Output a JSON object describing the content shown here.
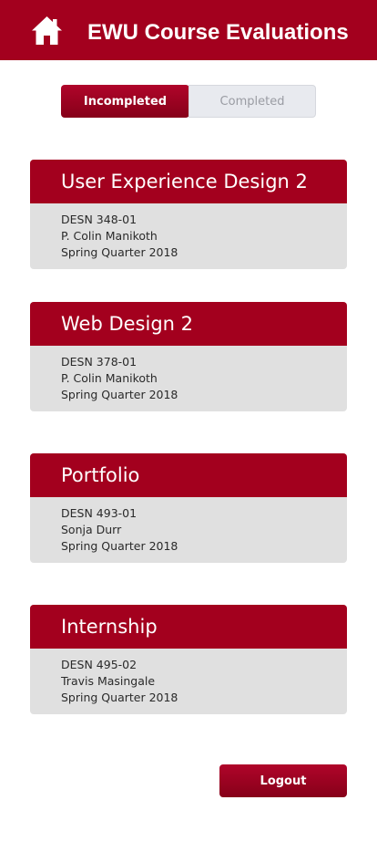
{
  "header": {
    "title": "EWU Course Evaluations",
    "home_icon": "home-icon",
    "bg_color": "#a3001e"
  },
  "tabs": [
    {
      "label": "Incompleted",
      "active": true
    },
    {
      "label": "Completed",
      "active": false
    }
  ],
  "courses": [
    {
      "title": "User Experience Design 2",
      "code": "DESN 348-01",
      "instructor": "P. Colin Manikoth",
      "term": "Spring Quarter 2018"
    },
    {
      "title": "Web Design 2",
      "code": "DESN 378-01",
      "instructor": "P. Colin Manikoth",
      "term": "Spring Quarter 2018"
    },
    {
      "title": "Portfolio",
      "code": "DESN 493-01",
      "instructor": "Sonja Durr",
      "term": "Spring Quarter 2018"
    },
    {
      "title": "Internship",
      "code": "DESN 495-02",
      "instructor": "Travis Masingale",
      "term": "Spring Quarter 2018"
    }
  ],
  "logout_label": "Logout",
  "colors": {
    "accent": "#a3001e",
    "card_body": "#e0e0e0",
    "inactive_tab": "#e8eaef"
  }
}
